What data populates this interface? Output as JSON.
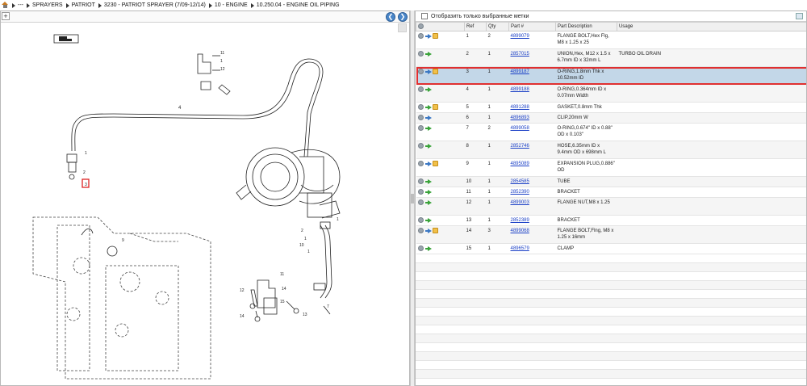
{
  "breadcrumb": {
    "items": [
      "---",
      "SPRAYERS",
      "PATRIOT",
      "3230 - PATRIOT SPRAYER (7/09-12/14)",
      "10 - ENGINE",
      "10.250.04 - ENGINE OIL PIPING"
    ]
  },
  "toolbar": {
    "zoom_label": "+",
    "back_glyph": "❮",
    "forward_glyph": "❯"
  },
  "filter": {
    "label": "Отобразить только выбранные метки"
  },
  "table": {
    "columns": [
      "",
      "Ref",
      "Qty",
      "Part #",
      "Part Description",
      "Usage"
    ],
    "rows": [
      {
        "ref": "1",
        "qty": "2",
        "part": "4899079",
        "desc": "FLANGE BOLT,Hex Flg, M8 x 1.25 x 25",
        "usage": "",
        "icons": "bp"
      },
      {
        "ref": "2",
        "qty": "1",
        "part": "2857015",
        "desc": "UNION,Hex, M12 x 1.5 x 6.7mm ID x 32mm L",
        "usage": "TURBO OIL DRAIN",
        "icons": "g"
      },
      {
        "ref": "3",
        "qty": "1",
        "part": "4899187",
        "desc": "O-RING,1.8mm Thk x 10.52mm ID",
        "usage": "",
        "icons": "bp"
      },
      {
        "ref": "4",
        "qty": "1",
        "part": "4899188",
        "desc": "O-RING,0.364mm ID x 0.07mm Width",
        "usage": "",
        "icons": "g"
      },
      {
        "ref": "5",
        "qty": "1",
        "part": "4891288",
        "desc": "GASKET,0.8mm Thk",
        "usage": "",
        "icons": "gp"
      },
      {
        "ref": "6",
        "qty": "1",
        "part": "4896893",
        "desc": "CLIP,20mm W",
        "usage": "",
        "icons": "b"
      },
      {
        "ref": "7",
        "qty": "2",
        "part": "4899058",
        "desc": "O-RING,0.674\" ID x 0.88\" OD x 0.103\"",
        "usage": "",
        "icons": "g"
      },
      {
        "ref": "8",
        "qty": "1",
        "part": "2852746",
        "desc": "HOSE,6.35mm ID x 9.4mm OD x 698mm L",
        "usage": "",
        "icons": "g"
      },
      {
        "ref": "9",
        "qty": "1",
        "part": "4895089",
        "desc": "EXPANSION PLUG,0.886\" OD",
        "usage": "",
        "icons": "bp"
      },
      {
        "ref": "10",
        "qty": "1",
        "part": "2854585",
        "desc": "TUBE",
        "usage": "",
        "icons": "g"
      },
      {
        "ref": "11",
        "qty": "1",
        "part": "2852390",
        "desc": "BRACKET",
        "usage": "",
        "icons": "g"
      },
      {
        "ref": "12",
        "qty": "1",
        "part": "4899003",
        "desc": "FLANGE NUT,M8 x 1.25",
        "usage": "",
        "icons": "g"
      },
      {
        "ref": "13",
        "qty": "1",
        "part": "2852389",
        "desc": "BRACKET",
        "usage": "",
        "icons": "g"
      },
      {
        "ref": "14",
        "qty": "3",
        "part": "4899068",
        "desc": "FLANGE BOLT,Flng, M8 x 1.25 x 16mm",
        "usage": "",
        "icons": "bp"
      },
      {
        "ref": "15",
        "qty": "1",
        "part": "4896579",
        "desc": "CLAMP",
        "usage": "",
        "icons": "g"
      }
    ],
    "selected_ref": "3"
  },
  "diagram": {
    "callouts": [
      "1",
      "1",
      "11",
      "12",
      "1",
      "1",
      "8",
      "4",
      "9",
      "1",
      "2",
      "1",
      "10",
      "1",
      "11",
      "12",
      "14",
      "15",
      "13",
      "1",
      "7",
      "1"
    ]
  },
  "colors": {
    "selection": "#c3d7e8",
    "selection_border": "#e03030",
    "link": "#1a3fc6"
  }
}
